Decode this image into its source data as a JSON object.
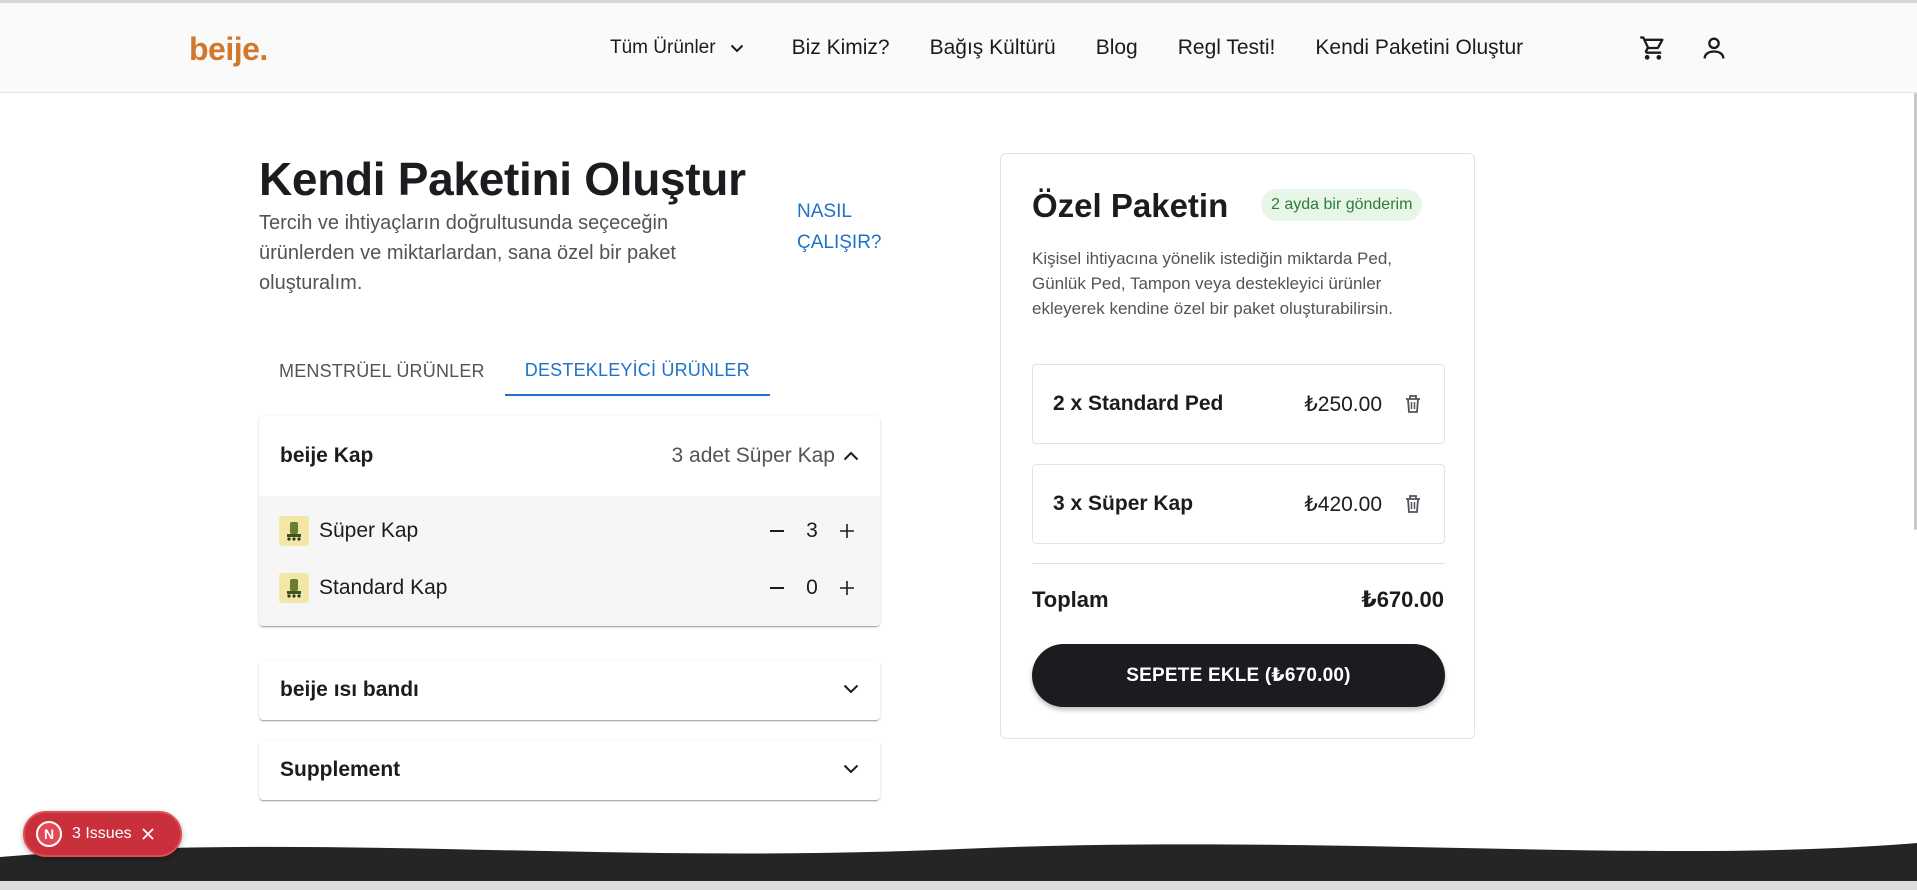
{
  "header": {
    "logo": "beije.",
    "nav": [
      {
        "label": "Tüm Ürünler"
      },
      {
        "label": "Biz Kimiz?"
      },
      {
        "label": "Bağış Kültürü"
      },
      {
        "label": "Blog"
      },
      {
        "label": "Regl Testi!"
      },
      {
        "label": "Kendi Paketini Oluştur"
      }
    ],
    "icons": [
      "cart-icon",
      "user-icon"
    ]
  },
  "main": {
    "title": "Kendi Paketini Oluştur",
    "description": "Tercih ve ihtiyaçların doğrultusunda seçeceğin ürünlerden ve miktarlardan, sana özel bir paket oluşturalım.",
    "how_link": "NASIL ÇALIŞIR?",
    "tabs": [
      {
        "label": "MENSTRÜEL ÜRÜNLER",
        "active": false
      },
      {
        "label": "DESTEKLEYİCİ ÜRÜNLER",
        "active": true
      }
    ],
    "accordions": [
      {
        "title": "beije Kap",
        "summary": "3 adet Süper Kap",
        "expanded": true,
        "products": [
          {
            "name": "Süper Kap",
            "quantity": "3"
          },
          {
            "name": "Standard Kap",
            "quantity": "0"
          }
        ]
      },
      {
        "title": "beije ısı bandı",
        "expanded": false
      },
      {
        "title": "Supplement",
        "expanded": false
      }
    ]
  },
  "card": {
    "title": "Özel Paketin",
    "badge": "2 ayda bir gönderim",
    "description": "Kişisel ihtiyacına yönelik istediğin miktarda Ped, Günlük Ped, Tampon veya destekleyici ürünler ekleyerek kendine özel bir paket oluşturabilirsin.",
    "items": [
      {
        "name": "2 x Standard Ped",
        "price": "₺250.00"
      },
      {
        "name": "3 x Süper Kap",
        "price": "₺420.00"
      }
    ],
    "total_label": "Toplam",
    "total_value": "₺670.00",
    "cta": "SEPETE EKLE (₺670.00)"
  },
  "issues_badge": {
    "logo_letter": "N",
    "label": "3 Issues"
  },
  "colors": {
    "brand": "#d2782d",
    "link": "#1e72c9",
    "dark": "#1c1b1f",
    "badge_bg": "#e8f5e9",
    "badge_text": "#2e7d32",
    "issues_red": "#c9303b"
  }
}
